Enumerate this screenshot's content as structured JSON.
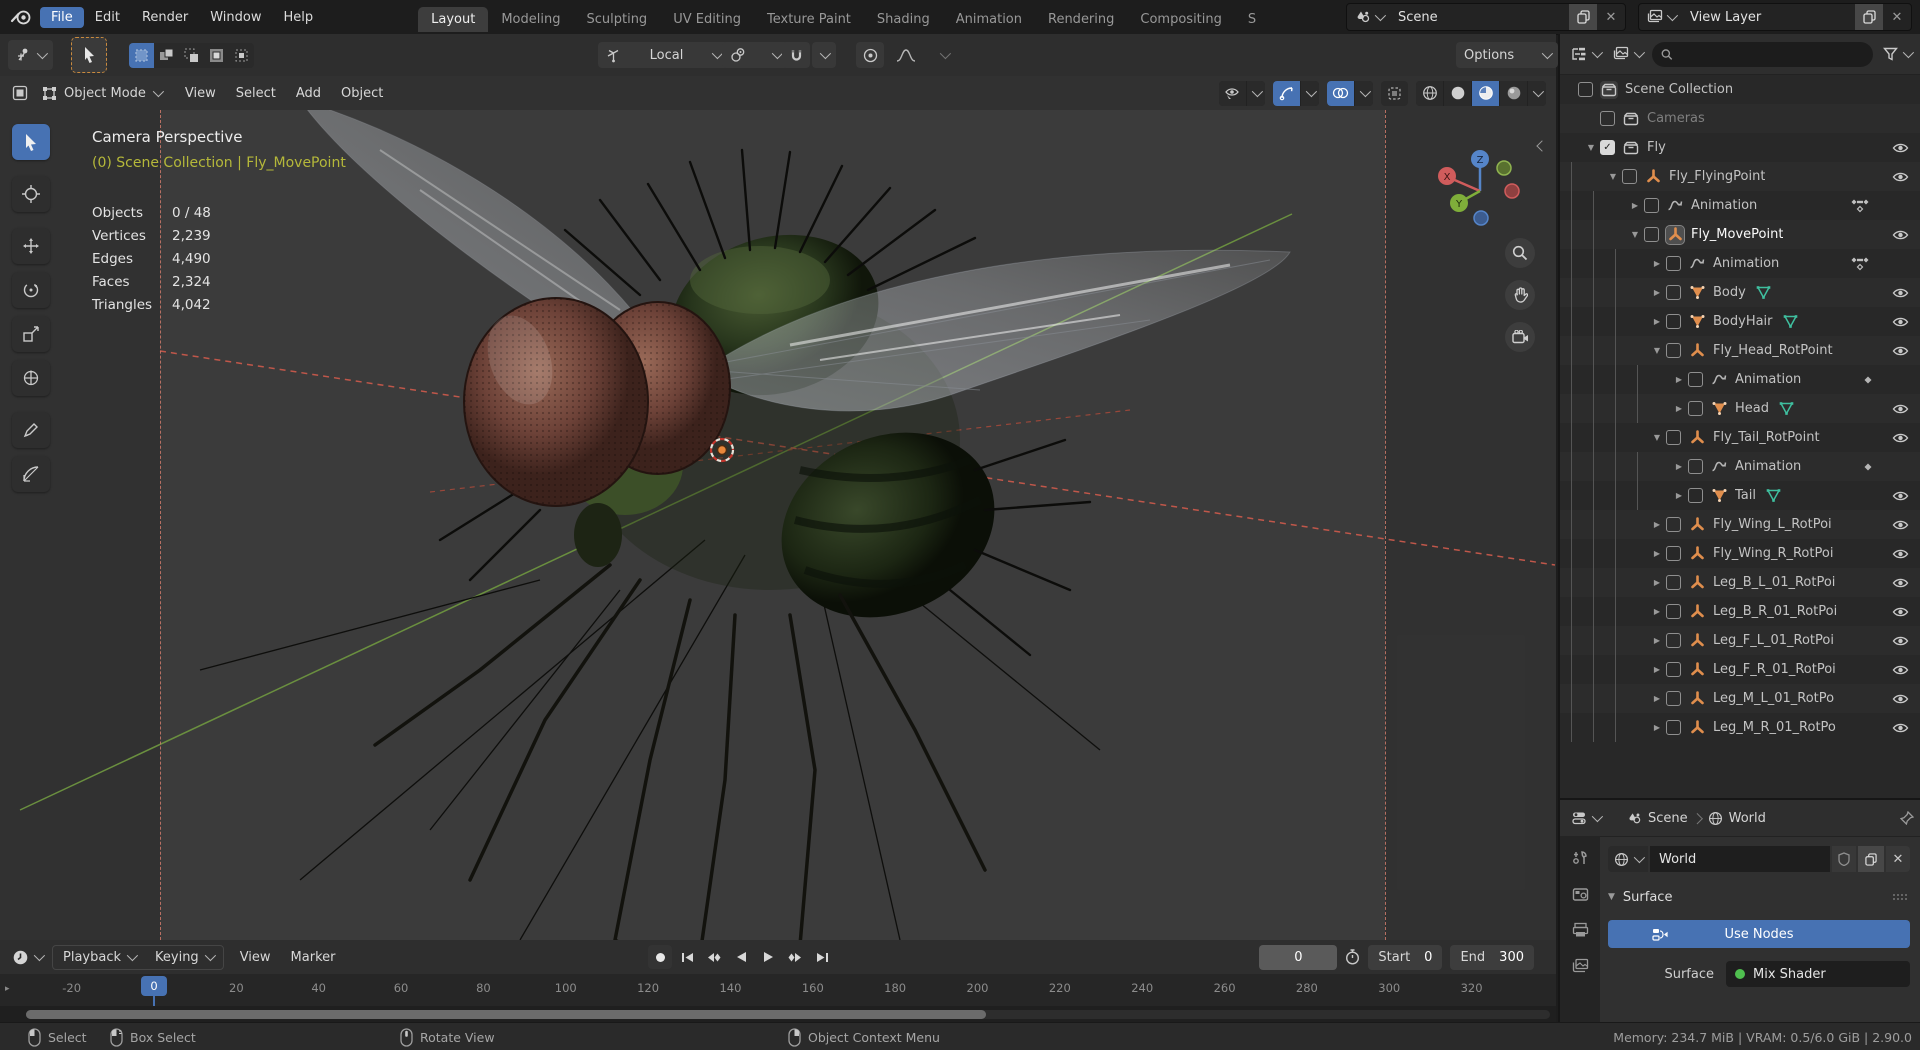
{
  "colors": {
    "accent_blue": "#4772b3",
    "data_orange": "#e08e4d",
    "mesh_green": "#3fbf9f",
    "context_yellow": "#b5b83a",
    "node_green": "#4fbf4f"
  },
  "topbar": {
    "menus": [
      "File",
      "Edit",
      "Render",
      "Window",
      "Help"
    ],
    "active_menu": "File",
    "workspaces": [
      "Layout",
      "Modeling",
      "Sculpting",
      "UV Editing",
      "Texture Paint",
      "Shading",
      "Animation",
      "Rendering",
      "Compositing",
      "S"
    ],
    "active_workspace": "Layout",
    "scene_selector": "Scene",
    "view_layer_selector": "View Layer"
  },
  "tool_settings": {
    "orientation": "Local",
    "options_label": "Options"
  },
  "viewport_header": {
    "mode": "Object Mode",
    "menus": [
      "View",
      "Select",
      "Add",
      "Object"
    ]
  },
  "viewport": {
    "view_name": "Camera Perspective",
    "context_path": "(0) Scene Collection | Fly_MovePoint",
    "stats": [
      {
        "label": "Objects",
        "value": "0 / 48"
      },
      {
        "label": "Vertices",
        "value": "2,239"
      },
      {
        "label": "Edges",
        "value": "4,490"
      },
      {
        "label": "Faces",
        "value": "2,324"
      },
      {
        "label": "Triangles",
        "value": "4,042"
      }
    ],
    "gizmo": {
      "x": "X",
      "y": "Y",
      "z": "Z"
    }
  },
  "outliner": {
    "search_placeholder": "",
    "rows": [
      {
        "indent": 0,
        "icon": "collection",
        "label": "Scene Collection",
        "softbox": true
      },
      {
        "indent": 1,
        "checkbox": "unchecked",
        "icon": "collection",
        "label": "Cameras",
        "dim": true
      },
      {
        "indent": 1,
        "disclosure": "down",
        "checkbox": "checked",
        "icon": "collection",
        "label": "Fly",
        "eye": true
      },
      {
        "indent": 2,
        "disclosure": "down",
        "icon": "empty",
        "label": "Fly_FlyingPoint",
        "eye": true
      },
      {
        "indent": 3,
        "disclosure": "right",
        "icon": "anim",
        "label": "Animation",
        "keys": true
      },
      {
        "indent": 3,
        "disclosure": "down",
        "icon": "empty",
        "label": "Fly_MovePoint",
        "selected": true,
        "eye": true
      },
      {
        "indent": 4,
        "disclosure": "right",
        "icon": "anim",
        "label": "Animation",
        "keys": true
      },
      {
        "indent": 4,
        "disclosure": "right",
        "icon": "mesh",
        "label": "Body",
        "meshdata": true,
        "eye": true
      },
      {
        "indent": 4,
        "disclosure": "right",
        "icon": "mesh",
        "label": "BodyHair",
        "meshdata": true,
        "eye": true
      },
      {
        "indent": 4,
        "disclosure": "down",
        "icon": "empty",
        "label": "Fly_Head_RotPoint",
        "eye": true
      },
      {
        "indent": 5,
        "disclosure": "right",
        "icon": "anim",
        "label": "Animation",
        "dot": true
      },
      {
        "indent": 5,
        "disclosure": "right",
        "icon": "mesh",
        "label": "Head",
        "meshdata": true,
        "eye": true
      },
      {
        "indent": 4,
        "disclosure": "down",
        "icon": "empty",
        "label": "Fly_Tail_RotPoint",
        "eye": true
      },
      {
        "indent": 5,
        "disclosure": "right",
        "icon": "anim",
        "label": "Animation",
        "dot": true
      },
      {
        "indent": 5,
        "disclosure": "right",
        "icon": "mesh",
        "label": "Tail",
        "meshdata": true,
        "eye": true
      },
      {
        "indent": 4,
        "disclosure": "right",
        "icon": "empty",
        "label": "Fly_Wing_L_RotPoi",
        "eye": true
      },
      {
        "indent": 4,
        "disclosure": "right",
        "icon": "empty",
        "label": "Fly_Wing_R_RotPoi",
        "eye": true
      },
      {
        "indent": 4,
        "disclosure": "right",
        "icon": "empty",
        "label": "Leg_B_L_01_RotPoi",
        "eye": true
      },
      {
        "indent": 4,
        "disclosure": "right",
        "icon": "empty",
        "label": "Leg_B_R_01_RotPoi",
        "eye": true
      },
      {
        "indent": 4,
        "disclosure": "right",
        "icon": "empty",
        "label": "Leg_F_L_01_RotPoi",
        "eye": true
      },
      {
        "indent": 4,
        "disclosure": "right",
        "icon": "empty",
        "label": "Leg_F_R_01_RotPoi",
        "eye": true
      },
      {
        "indent": 4,
        "disclosure": "right",
        "icon": "empty",
        "label": "Leg_M_L_01_RotPo",
        "eye": true
      },
      {
        "indent": 4,
        "disclosure": "right",
        "icon": "empty",
        "label": "Leg_M_R_01_RotPo",
        "eye": true
      }
    ]
  },
  "properties": {
    "breadcrumb_scene": "Scene",
    "breadcrumb_world": "World",
    "world_name": "World",
    "surface_panel_title": "Surface",
    "use_nodes_label": "Use Nodes",
    "surface_label": "Surface",
    "surface_value": "Mix Shader"
  },
  "timeline": {
    "menus": [
      "Playback",
      "Keying",
      "View",
      "Marker"
    ],
    "current_frame": "0",
    "start_label": "Start",
    "start_value": "0",
    "end_label": "End",
    "end_value": "300",
    "playhead": "0",
    "ticks": [
      "-20",
      "0",
      "20",
      "40",
      "60",
      "80",
      "100",
      "120",
      "140",
      "160",
      "180",
      "200",
      "220",
      "240",
      "260",
      "280",
      "300",
      "320"
    ]
  },
  "status_bar": {
    "hints": [
      "Select",
      "Box Select",
      "Rotate View",
      "Object Context Menu"
    ],
    "stats": "Memory: 234.7 MiB | VRAM: 0.5/6.0 GiB | 2.90.0"
  }
}
